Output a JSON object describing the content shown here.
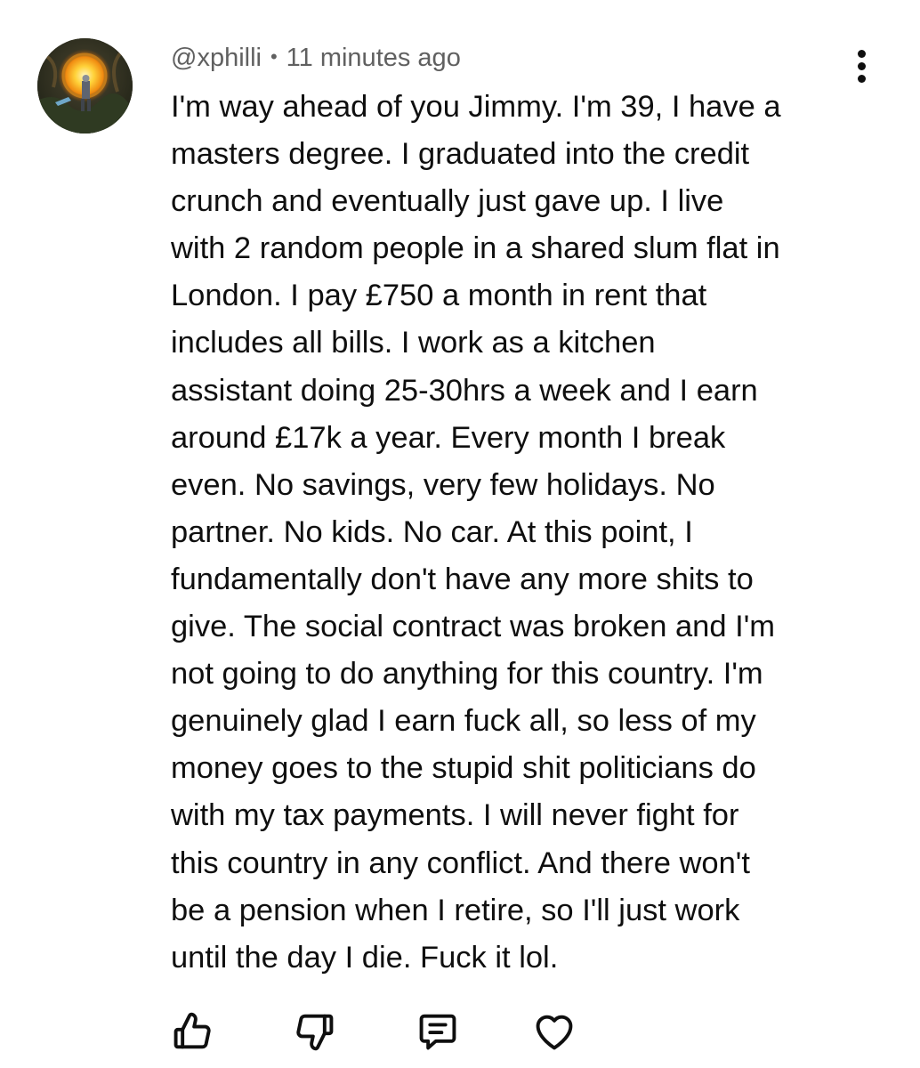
{
  "comment": {
    "author": "@xphilli",
    "separator": "•",
    "timestamp": "11 minutes ago",
    "avatar_icon": "game-character-portal-avatar",
    "text_lines": [
      "I'm way ahead of you Jimmy. I'm 39, I have a",
      "masters degree. I graduated into the credit",
      "crunch and eventually just gave up. I live",
      "with 2 random people in a shared slum flat in",
      "London. I pay £750 a month in rent that",
      "includes all bills. I work as a kitchen",
      "assistant doing 25-30hrs a week and I earn",
      "around £17k a year. Every month I break",
      "even. No savings, very few holidays. No",
      "partner. No kids. No car. At this point, I",
      "fundamentally don't have any more shits to",
      "give. The social contract was broken and I'm",
      "not going to do anything for this country. I'm",
      "genuinely glad I earn fuck all, so less of my",
      "money goes to the stupid shit politicians do",
      "with my tax payments. I will never fight for",
      "this country in any conflict. And there won't",
      "be a pension when I retire, so I'll just work",
      "until the day I die. Fuck it lol."
    ]
  },
  "menu_icon": "vertical-ellipsis-icon",
  "actions": [
    {
      "icon": "thumbs-up-icon"
    },
    {
      "icon": "thumbs-down-icon"
    },
    {
      "icon": "reply-icon"
    },
    {
      "icon": "heart-icon"
    }
  ],
  "colors": {
    "text": "#0f0f0f",
    "meta": "#606060",
    "background": "#ffffff"
  }
}
